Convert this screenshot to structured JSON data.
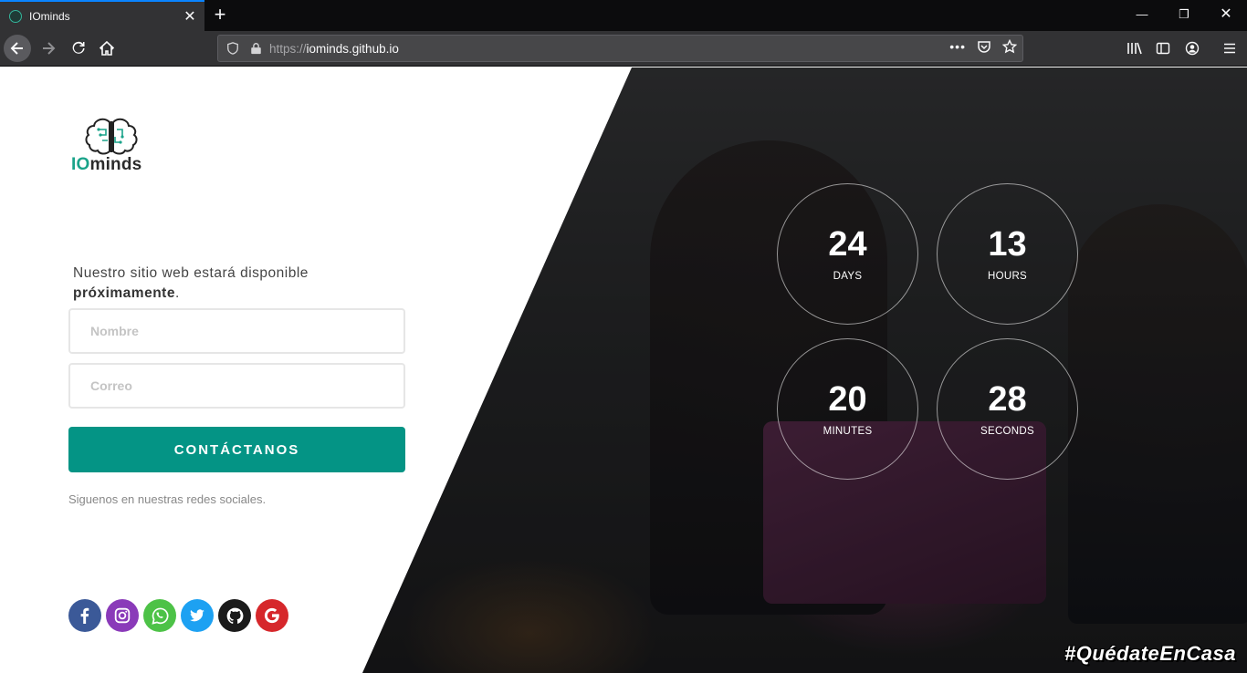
{
  "browser": {
    "tab_title": "IOminds",
    "url_protocol": "https://",
    "url_host": "iominds.github.io"
  },
  "page": {
    "logo_io": "IO",
    "logo_minds": "minds",
    "tagline_main": "Nuestro sitio web estará disponible",
    "tagline_bold": "próximamente",
    "tagline_end": ".",
    "name_placeholder": "Nombre",
    "email_placeholder": "Correo",
    "cta_label": "CONTÁCTANOS",
    "social_text": "Siguenos en nuestras redes sociales.",
    "social_links": [
      {
        "name": "facebook",
        "color": "#3b5998"
      },
      {
        "name": "instagram",
        "color": "#8a3ab9"
      },
      {
        "name": "whatsapp",
        "color": "#4dc247"
      },
      {
        "name": "twitter",
        "color": "#1da1f2"
      },
      {
        "name": "github",
        "color": "#1b1b1b"
      },
      {
        "name": "google",
        "color": "#d6272b"
      }
    ],
    "countdown": {
      "days": {
        "value": "24",
        "label": "DAYS"
      },
      "hours": {
        "value": "13",
        "label": "HOURS"
      },
      "minutes": {
        "value": "20",
        "label": "MINUTES"
      },
      "seconds": {
        "value": "28",
        "label": "SECONDS"
      }
    },
    "hashtag": "#QuédateEnCasa",
    "accent_color": "#049485"
  }
}
